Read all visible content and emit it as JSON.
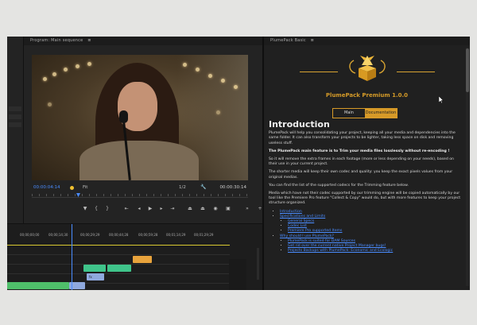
{
  "program_monitor": {
    "title": "Program: Main sequence",
    "menu_icon": "≡",
    "timecode_current": "00:00:04:14",
    "fit_label": "Fit",
    "resolution": "1/2",
    "timecode_duration": "00:00:30:14",
    "transport_icons": [
      "marker-icon",
      "in-point-icon",
      "out-point-icon",
      "go-to-in-icon",
      "step-back-icon",
      "play-icon",
      "step-forward-icon",
      "go-to-out-icon",
      "lift-icon",
      "extract-icon",
      "export-frame-icon",
      "compare-icon",
      "settings-icon",
      "add-icon"
    ]
  },
  "plumepack": {
    "panel_title": "PlumePack Basic",
    "menu_icon": "≡",
    "product_title": "PlumePack Premium 1.0.0",
    "tabs": [
      {
        "label": "Main",
        "active": false
      },
      {
        "label": "Documentation",
        "active": true
      }
    ],
    "heading": "Introduction",
    "p1": "PlumePack will help you consolidating your project, keeping all your media and dependencies into the same folder. It can also transform your projects to be lighter, taking less space on disk and removing useless stuff.",
    "p2": "The PlumePack main feature is to Trim your media files losslessly without re-encoding !",
    "p3": "So it will remove the extra frames in each footage (more or less depending on your needs), based on their use in your current project.",
    "p4": "The shorter media will keep their own codec and quality: you keep the exact pixels values from your original medias.",
    "p5": "You can find the list of the supported codecs for the Trimming feature below.",
    "p6": "Media which have not their codec supported by our trimming engine will be copied automatically by our tool like the Premiere Pro feature \"Collect & Copy\" would do, but with more features to keep your project structure organized.",
    "toc": {
      "introduction": "Introduction",
      "specs": "Specifications and Limits",
      "general_specs": "General Specs",
      "codec_list": "Codec List",
      "premiere_versions": "Premiere Pro supported Items",
      "why": "Why should I use PlumePack?",
      "why_1": "PlumePack is suited for DAM Sources",
      "why_2": "Get rid over the current native Project Manager bugs!",
      "why_3": "Projects Backups with PlumePack: Economic and Ecologic"
    }
  },
  "timeline": {
    "ruler_labels": [
      "00;00;00;00",
      "00;00;14;30",
      "00;00;29;29",
      "00;00;44;28",
      "00;00;59;28",
      "00;01;14;29",
      "00;01;29;29",
      "00;01;44;29"
    ],
    "clips": [
      {
        "label": "",
        "color": "#e8a33c"
      },
      {
        "label": "",
        "color": "#3fc48a"
      },
      {
        "label": "",
        "color": "#3fc48a"
      },
      {
        "label": "fx",
        "color": "#8fa9de"
      },
      {
        "label": "",
        "color": "#4fbf6a"
      },
      {
        "label": "",
        "color": "#8fa9de"
      }
    ]
  }
}
